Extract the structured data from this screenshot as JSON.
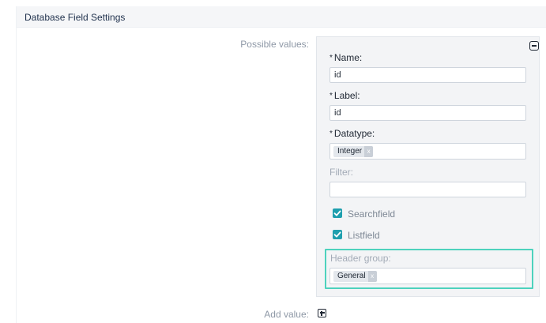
{
  "section": {
    "title": "Database Field Settings"
  },
  "possible_values": {
    "label": "Possible values:",
    "name": {
      "label": "Name:",
      "value": "id"
    },
    "field_label": {
      "label": "Label:",
      "value": "id"
    },
    "datatype": {
      "label": "Datatype:",
      "selected_tag": "Integer",
      "remove_glyph": "x"
    },
    "filter": {
      "label": "Filter:",
      "value": ""
    },
    "searchfield": {
      "label": "Searchfield",
      "checked": true
    },
    "listfield": {
      "label": "Listfield",
      "checked": true
    },
    "header_group": {
      "label": "Header group:",
      "selected_tag": "General",
      "remove_glyph": "x"
    }
  },
  "add_value": {
    "label": "Add value:"
  },
  "required_marker": "*",
  "colors": {
    "accent_teal": "#1e9fae",
    "highlight": "#4dd2bd",
    "panel_bg": "#f3f4f6",
    "header_bg": "#f5f6f8"
  },
  "icons": {
    "collapse": "minus-square-icon",
    "add": "plus-square-icon",
    "check": "checkmark-icon"
  }
}
